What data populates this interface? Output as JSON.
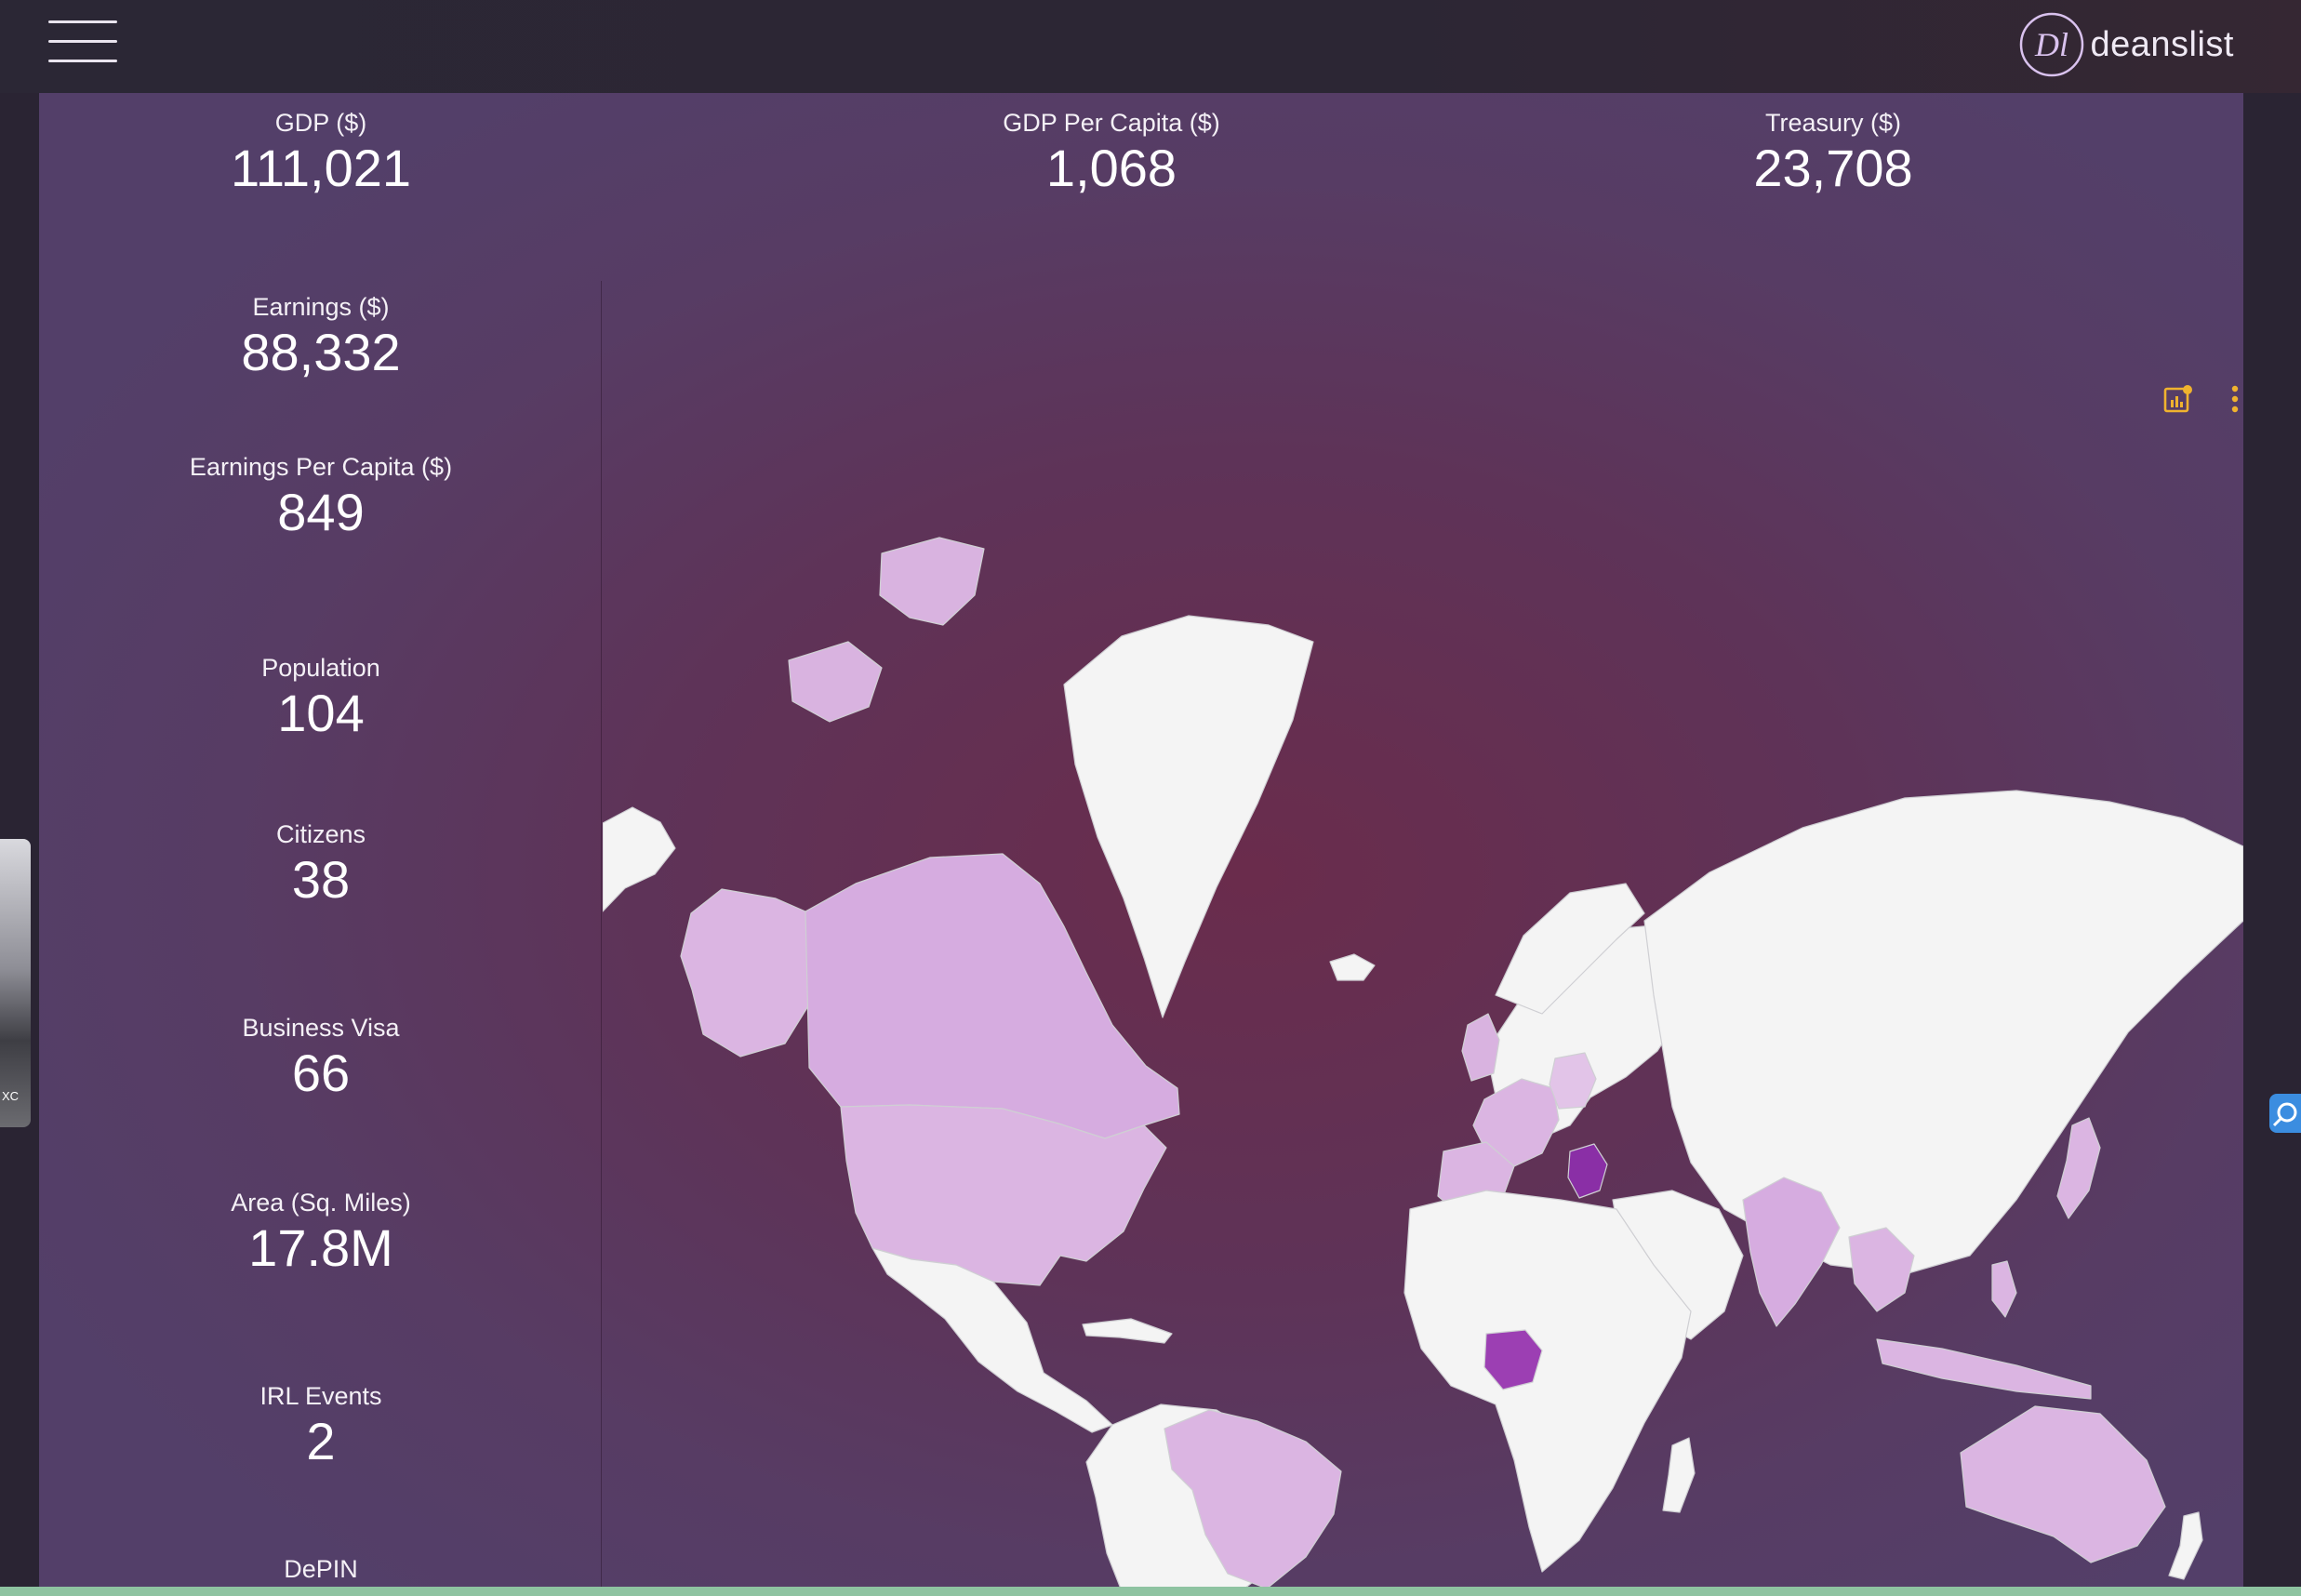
{
  "app": {
    "brand_name": "deanslist",
    "brand_mark": "Dl"
  },
  "header_stats": [
    {
      "label": "GDP ($)",
      "value": "111,021"
    },
    {
      "label": "GDP Per Capita ($)",
      "value": "1,068"
    },
    {
      "label": "Treasury ($)",
      "value": "23,708"
    }
  ],
  "side_stats": [
    {
      "label": "Earnings ($)",
      "value": "88,332"
    },
    {
      "label": "Earnings Per Capita ($)",
      "value": "849"
    },
    {
      "label": "Population",
      "value": "104"
    },
    {
      "label": "Citizens",
      "value": "38"
    },
    {
      "label": "Business Visa",
      "value": "66"
    },
    {
      "label": "Area (Sq. Miles)",
      "value": "17.8M"
    },
    {
      "label": "IRL Events",
      "value": "2"
    },
    {
      "label": "DePIN",
      "value": ""
    }
  ],
  "map": {
    "icons": [
      "chart-settings-icon",
      "more-vert-icon"
    ],
    "legend_colors": {
      "none": "#f4f4f4",
      "low": "#dbb5e2",
      "mid": "#c48ad0",
      "high": "#9c3fb3",
      "top": "#7a1f90"
    },
    "accent_icon_color": "#f0b32e"
  },
  "side_thumb": {
    "tag": "XC"
  }
}
